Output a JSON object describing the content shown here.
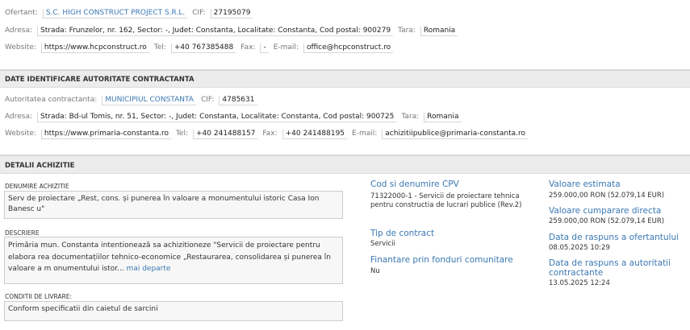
{
  "ofertant": {
    "label": "Ofertant:",
    "name": "S.C. HIGH CONSTRUCT PROJECT S.R.L.",
    "cif_label": "CIF:",
    "cif": "27195079",
    "adresa_label": "Adresa:",
    "adresa": "Strada: Frunzelor, nr. 162, Sector: -, Judet: Constanta, Localitate: Constanta, Cod postal: 900279",
    "tara_label": "Tara:",
    "tara": "Romania",
    "website_label": "Website:",
    "website": "https://www.hcpconstruct.ro",
    "tel_label": "Tel:",
    "tel": "+40 767385488",
    "fax_label": "Fax:",
    "fax": "-",
    "email_label": "E-mail:",
    "email": "office@hcpconstruct.ro"
  },
  "autoritate": {
    "section_title": "DATE IDENTIFICARE AUTORITATE CONTRACTANTA",
    "label": "Autoritatea contractanta:",
    "name": "MUNICIPIUL CONSTANTA",
    "cif_label": "CIF:",
    "cif": "4785631",
    "adresa_label": "Adresa:",
    "adresa": "Strada: Bd-ul Tomis, nr. 51, Sector: -, Judet: Constanta, Localitate: Constanta, Cod postal: 900725",
    "tara_label": "Tara:",
    "tara": "Romania",
    "website_label": "Website:",
    "website": "https://www.primaria-constanta.ro",
    "tel_label": "Tel:",
    "tel": "+40 241488157",
    "fax_label": "Fax:",
    "fax": "+40 241488195",
    "email_label": "E-mail:",
    "email": "achizitiipublice@primaria-constanta.ro"
  },
  "achizitie": {
    "section_title": "DETALII ACHIZITIE",
    "denumire_label": "DENUMIRE ACHIZITIE",
    "denumire": "Serv de proiectare „Rest, cons. și punerea în valoare a monumentului istoric Casa Ion Banesc u\"",
    "descriere_label": "DESCRIERE",
    "descriere": "Primăria mun. Constanta intentionează sa achizitioneze \"Servicii de proiectare pentru elabora rea documentațiilor tehnico-economice „Restaurarea, consolidarea și punerea în valoare a m onumentului istor...",
    "mai_departe": "mai departe",
    "conditii_label": "CONDITII DE LIVRARE:",
    "conditii": "Conform specificatii din caietul de sarcini",
    "cpv_head": "Cod si denumire CPV",
    "cpv": "71322000-1 - Servicii de proiectare tehnica pentru constructia de lucrari publice (Rev.2)",
    "tip_head": "Tip de contract",
    "tip": "Servicii",
    "finantare_head": "Finantare prin fonduri comunitare",
    "finantare": "Nu",
    "valoare_head": "Valoare estimata",
    "valoare": "259.000,00 RON (52.079,14 EUR)",
    "valoare_cd_head": "Valoare cumparare directa",
    "valoare_cd": "259.000,00 RON (52.079,14 EUR)",
    "data_ofertant_head": "Data de raspuns a ofertantului",
    "data_ofertant": "08.05.2025 10:29",
    "data_autoritate_head": "Data de raspuns a autoritatii contractante",
    "data_autoritate": "13.05.2025 12:24"
  }
}
